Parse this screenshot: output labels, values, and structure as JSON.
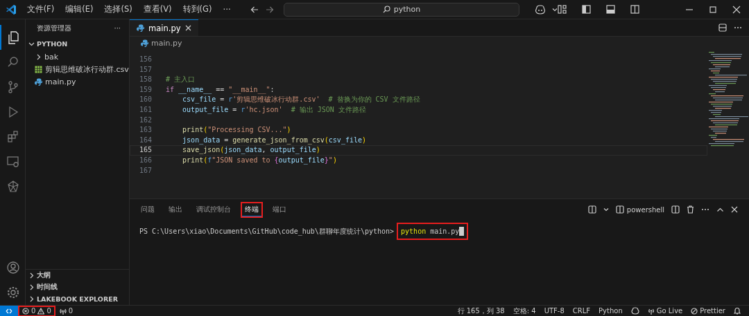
{
  "title_bar": {
    "menus": [
      "文件(F)",
      "编辑(E)",
      "选择(S)",
      "查看(V)",
      "转到(G)"
    ],
    "more": "···",
    "search": {
      "value": "python"
    }
  },
  "activity_bar": [
    {
      "kind": "files",
      "selected": true
    },
    {
      "kind": "search",
      "selected": false
    },
    {
      "kind": "source-control",
      "selected": false
    },
    {
      "kind": "run",
      "selected": false
    },
    {
      "kind": "extensions",
      "selected": false
    },
    {
      "kind": "remote",
      "selected": false
    },
    {
      "kind": "tool",
      "selected": false
    }
  ],
  "sidebar": {
    "title": "资源管理器",
    "more": "···",
    "section": {
      "label": "PYTHON",
      "expanded": true,
      "items": [
        {
          "kind": "folder",
          "label": "bak",
          "expanded": false
        },
        {
          "kind": "csv",
          "label": "剪辑思维破冰行动群.csv"
        },
        {
          "kind": "python",
          "label": "main.py"
        }
      ]
    },
    "bottom_sections": [
      {
        "label": "大纲",
        "expanded": false
      },
      {
        "label": "时间线",
        "expanded": false
      },
      {
        "label": "LAKEBOOK EXPLORER",
        "expanded": false
      }
    ]
  },
  "editor": {
    "tabs": [
      {
        "label": "main.py",
        "selected": true
      }
    ],
    "breadcrumb": "main.py",
    "lines": [
      {
        "number": "156",
        "current": false
      },
      {
        "number": "157",
        "current": false
      },
      {
        "number": "158",
        "current": false,
        "tokens": [
          {
            "kind": "comment",
            "text": "# 主入口"
          }
        ]
      },
      {
        "number": "159",
        "current": false,
        "tokens": [
          {
            "kind": "ctrl",
            "text": "if"
          },
          {
            "kind": "var",
            "text": " __name__"
          },
          {
            "kind": "plain",
            "text": " == "
          },
          {
            "kind": "str",
            "text": "\"__main__\""
          },
          {
            "kind": "plain",
            "text": ":"
          }
        ]
      },
      {
        "number": "160",
        "current": false,
        "tokens": [
          {
            "kind": "var",
            "text": "    csv_file"
          },
          {
            "kind": "plain",
            "text": " = "
          },
          {
            "kind": "kw",
            "text": "r"
          },
          {
            "kind": "str",
            "text": "'剪辑思维破冰行动群.csv'"
          },
          {
            "kind": "comment",
            "text": "  # 替换为你的 CSV 文件路径"
          }
        ]
      },
      {
        "number": "161",
        "current": false,
        "tokens": [
          {
            "kind": "var",
            "text": "    output_file"
          },
          {
            "kind": "plain",
            "text": " = "
          },
          {
            "kind": "kw",
            "text": "r"
          },
          {
            "kind": "str",
            "text": "'hc.json'"
          },
          {
            "kind": "comment",
            "text": "  # 输出 JSON 文件路径"
          }
        ]
      },
      {
        "number": "162",
        "current": false
      },
      {
        "number": "163",
        "current": false,
        "tokens": [
          {
            "kind": "fn",
            "text": "    print"
          },
          {
            "kind": "paren",
            "text": "("
          },
          {
            "kind": "str",
            "text": "\"Processing CSV...\""
          },
          {
            "kind": "paren",
            "text": ")"
          }
        ]
      },
      {
        "number": "164",
        "current": false,
        "tokens": [
          {
            "kind": "var",
            "text": "    json_data"
          },
          {
            "kind": "plain",
            "text": " = "
          },
          {
            "kind": "fn",
            "text": "generate_json_from_csv"
          },
          {
            "kind": "paren",
            "text": "("
          },
          {
            "kind": "var",
            "text": "csv_file"
          },
          {
            "kind": "paren",
            "text": ")"
          }
        ]
      },
      {
        "number": "165",
        "current": true,
        "tokens": [
          {
            "kind": "fn",
            "text": "    save_json"
          },
          {
            "kind": "paren",
            "text": "("
          },
          {
            "kind": "var",
            "text": "json_data"
          },
          {
            "kind": "plain",
            "text": ", "
          },
          {
            "kind": "var",
            "text": "output_file"
          },
          {
            "kind": "paren",
            "text": ")"
          }
        ]
      },
      {
        "number": "166",
        "current": false,
        "tokens": [
          {
            "kind": "fn",
            "text": "    print"
          },
          {
            "kind": "paren",
            "text": "("
          },
          {
            "kind": "kw",
            "text": "f"
          },
          {
            "kind": "str",
            "text": "\"JSON saved to "
          },
          {
            "kind": "brace",
            "text": "{"
          },
          {
            "kind": "var",
            "text": "output_file"
          },
          {
            "kind": "brace",
            "text": "}"
          },
          {
            "kind": "str",
            "text": "\""
          },
          {
            "kind": "paren",
            "text": ")"
          }
        ]
      },
      {
        "number": "167",
        "current": false
      }
    ]
  },
  "panel": {
    "tabs": [
      {
        "label": "问题",
        "selected": false,
        "highlighted": false
      },
      {
        "label": "输出",
        "selected": false,
        "highlighted": false
      },
      {
        "label": "调试控制台",
        "selected": false,
        "highlighted": false
      },
      {
        "label": "终端",
        "selected": true,
        "highlighted": true
      },
      {
        "label": "端口",
        "selected": false,
        "highlighted": false
      }
    ],
    "shell": "powershell",
    "prompt": "PS C:\\Users\\xiao\\Documents\\GitHub\\code_hub\\群聊年度统计\\python>",
    "command": {
      "program": "python",
      "args": "main.py",
      "highlighted": true
    }
  },
  "status_bar": {
    "errors": "0",
    "warnings": "0",
    "ports": "0",
    "problems_highlighted": true,
    "right": [
      {
        "kind": "text",
        "text": "行 165，列 38"
      },
      {
        "kind": "text",
        "text": "空格: 4"
      },
      {
        "kind": "text",
        "text": "UTF-8"
      },
      {
        "kind": "text",
        "text": "CRLF"
      },
      {
        "kind": "text",
        "text": "Python"
      },
      {
        "kind": "copilot"
      },
      {
        "kind": "golive",
        "text": "Go Live"
      },
      {
        "kind": "prettier",
        "text": "Prettier"
      },
      {
        "kind": "bell"
      }
    ]
  }
}
